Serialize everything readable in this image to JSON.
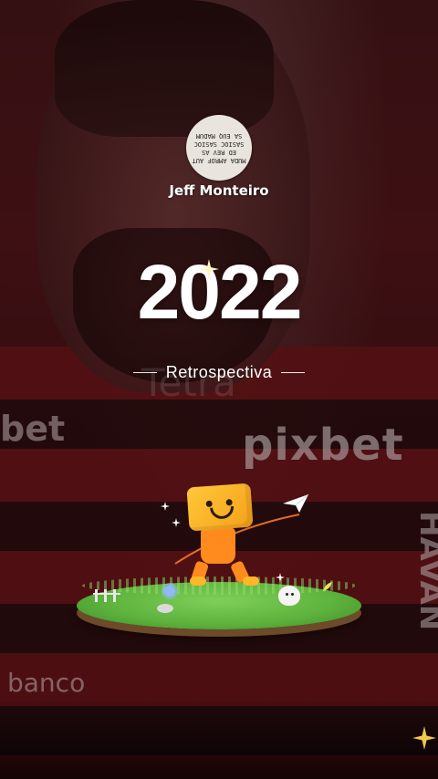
{
  "header": {
    "stamp_text": "MUDA AMROF AUT ED REV AS SASIOC SASIOC SA EUQ MADUM",
    "author": "Jeff Monteiro"
  },
  "hero": {
    "year": "2022",
    "subtitle": "Retrospectiva"
  },
  "background_text": {
    "sponsor_main": "pixbet",
    "sponsor_left": "bet",
    "bank": "banco",
    "side": "HAVAN",
    "watermark": "Tetra"
  },
  "colors": {
    "accent": "#f5a019",
    "text": "#ffffff",
    "jersey_red": "#6d1418"
  }
}
